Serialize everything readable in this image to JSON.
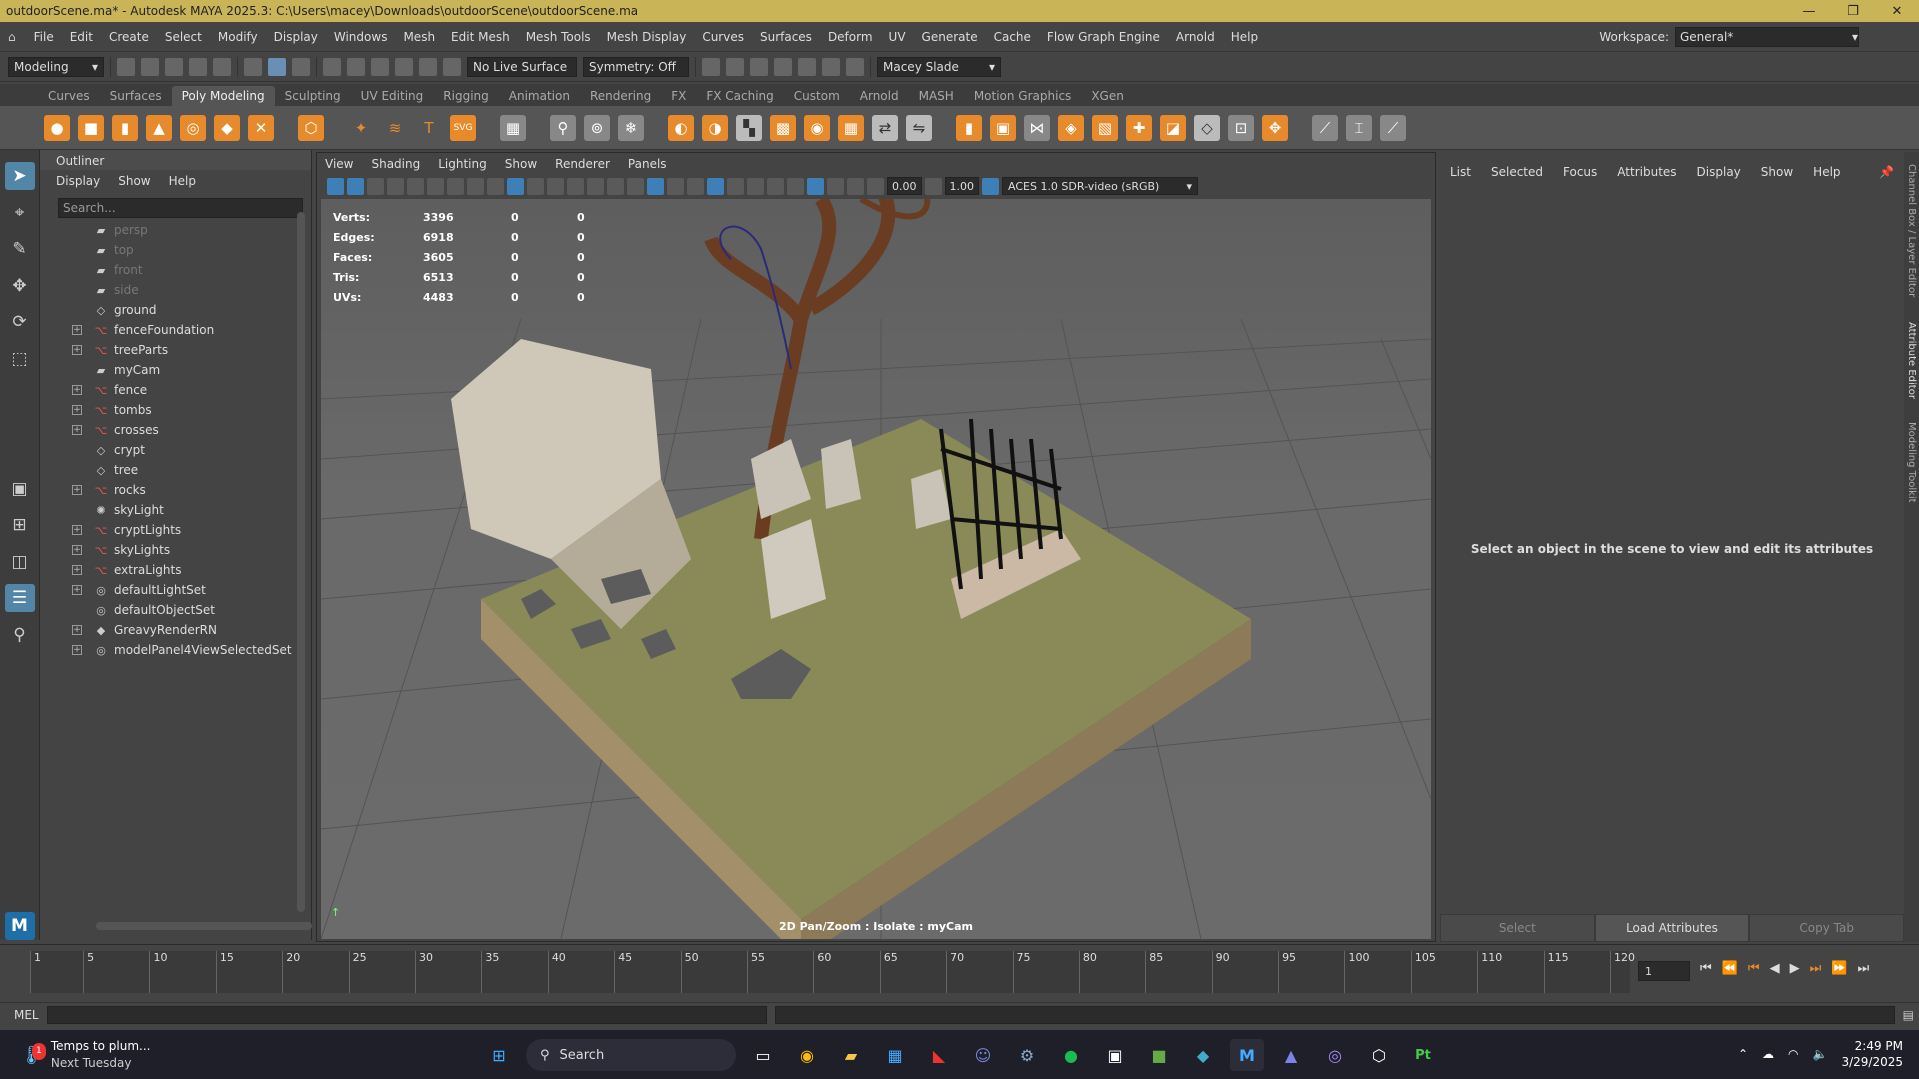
{
  "window": {
    "title": "outdoorScene.ma* - Autodesk MAYA 2025.3: C:\\Users\\macey\\Downloads\\outdoorScene\\outdoorScene.ma"
  },
  "menus": [
    "File",
    "Edit",
    "Create",
    "Select",
    "Modify",
    "Display",
    "Windows",
    "Mesh",
    "Edit Mesh",
    "Mesh Tools",
    "Mesh Display",
    "Curves",
    "Surfaces",
    "Deform",
    "UV",
    "Generate",
    "Cache",
    "Flow Graph Engine",
    "Arnold",
    "Help"
  ],
  "workspace": {
    "label": "Workspace:",
    "value": "General*"
  },
  "status": {
    "mode": "Modeling",
    "live_surface": "No Live Surface",
    "symmetry": "Symmetry: Off",
    "user": "Macey Slade"
  },
  "shelf_tabs": [
    "Curves",
    "Surfaces",
    "Poly Modeling",
    "Sculpting",
    "UV Editing",
    "Rigging",
    "Animation",
    "Rendering",
    "FX",
    "FX Caching",
    "Custom",
    "Arnold",
    "MASH",
    "Motion Graphics",
    "XGen"
  ],
  "outliner": {
    "title": "Outliner",
    "menu": [
      "Display",
      "Show",
      "Help"
    ],
    "search_placeholder": "Search...",
    "items": [
      {
        "label": "persp",
        "icon": "camera",
        "dim": true,
        "expand": false
      },
      {
        "label": "top",
        "icon": "camera",
        "dim": true,
        "expand": false
      },
      {
        "label": "front",
        "icon": "camera",
        "dim": true,
        "expand": false
      },
      {
        "label": "side",
        "icon": "camera",
        "dim": true,
        "expand": false
      },
      {
        "label": "ground",
        "icon": "mesh",
        "dim": false,
        "expand": false
      },
      {
        "label": "fenceFoundation",
        "icon": "group",
        "dim": false,
        "expand": true
      },
      {
        "label": "treeParts",
        "icon": "group",
        "dim": false,
        "expand": true
      },
      {
        "label": "myCam",
        "icon": "camera",
        "dim": false,
        "expand": false
      },
      {
        "label": "fence",
        "icon": "group",
        "dim": false,
        "expand": true
      },
      {
        "label": "tombs",
        "icon": "group",
        "dim": false,
        "expand": true
      },
      {
        "label": "crosses",
        "icon": "group",
        "dim": false,
        "expand": true
      },
      {
        "label": "crypt",
        "icon": "mesh",
        "dim": false,
        "expand": false
      },
      {
        "label": "tree",
        "icon": "mesh",
        "dim": false,
        "expand": false
      },
      {
        "label": "rocks",
        "icon": "group",
        "dim": false,
        "expand": true
      },
      {
        "label": "skyLight",
        "icon": "light",
        "dim": false,
        "expand": false
      },
      {
        "label": "cryptLights",
        "icon": "group",
        "dim": false,
        "expand": true
      },
      {
        "label": "skyLights",
        "icon": "group",
        "dim": false,
        "expand": true
      },
      {
        "label": "extraLights",
        "icon": "group",
        "dim": false,
        "expand": true
      },
      {
        "label": "defaultLightSet",
        "icon": "set",
        "dim": false,
        "expand": true
      },
      {
        "label": "defaultObjectSet",
        "icon": "set",
        "dim": false,
        "expand": false
      },
      {
        "label": "GreavyRenderRN",
        "icon": "ref",
        "dim": false,
        "expand": true
      },
      {
        "label": "modelPanel4ViewSelectedSet",
        "icon": "set",
        "dim": false,
        "expand": true
      }
    ]
  },
  "viewport": {
    "menu": [
      "View",
      "Shading",
      "Lighting",
      "Show",
      "Renderer",
      "Panels"
    ],
    "field_a": "0.00",
    "field_b": "1.00",
    "colorspace": "ACES 1.0 SDR-video (sRGB)",
    "hud": [
      {
        "label": "Verts:",
        "v": "3396",
        "a": "0",
        "b": "0"
      },
      {
        "label": "Edges:",
        "v": "6918",
        "a": "0",
        "b": "0"
      },
      {
        "label": "Faces:",
        "v": "3605",
        "a": "0",
        "b": "0"
      },
      {
        "label": "Tris:",
        "v": "6513",
        "a": "0",
        "b": "0"
      },
      {
        "label": "UVs:",
        "v": "4483",
        "a": "0",
        "b": "0"
      }
    ],
    "caption": "2D Pan/Zoom : Isolate : myCam"
  },
  "attribute_editor": {
    "menu": [
      "List",
      "Selected",
      "Focus",
      "Attributes",
      "Display",
      "Show",
      "Help"
    ],
    "message": "Select an object in the scene to view and edit its attributes",
    "buttons": [
      "Select",
      "Load Attributes",
      "Copy Tab"
    ]
  },
  "side_tabs": [
    "Channel Box / Layer Editor",
    "Attribute Editor",
    "Modeling Toolkit"
  ],
  "timeline": {
    "ticks": [
      "1",
      "5",
      "10",
      "15",
      "20",
      "25",
      "30",
      "35",
      "40",
      "45",
      "50",
      "55",
      "60",
      "65",
      "70",
      "75",
      "80",
      "85",
      "90",
      "95",
      "100",
      "105",
      "110",
      "115",
      "120"
    ],
    "current_frame": "1"
  },
  "cmdline": {
    "label": "MEL"
  },
  "taskbar": {
    "weather_title": "Temps to plum...",
    "weather_sub": "Next Tuesday",
    "notification": "1",
    "search": "Search",
    "time": "2:49 PM",
    "date": "3/29/2025"
  },
  "colors": {
    "titlebar": "#c9b458",
    "accent": "#e68a2b",
    "selection": "#5285a6"
  }
}
